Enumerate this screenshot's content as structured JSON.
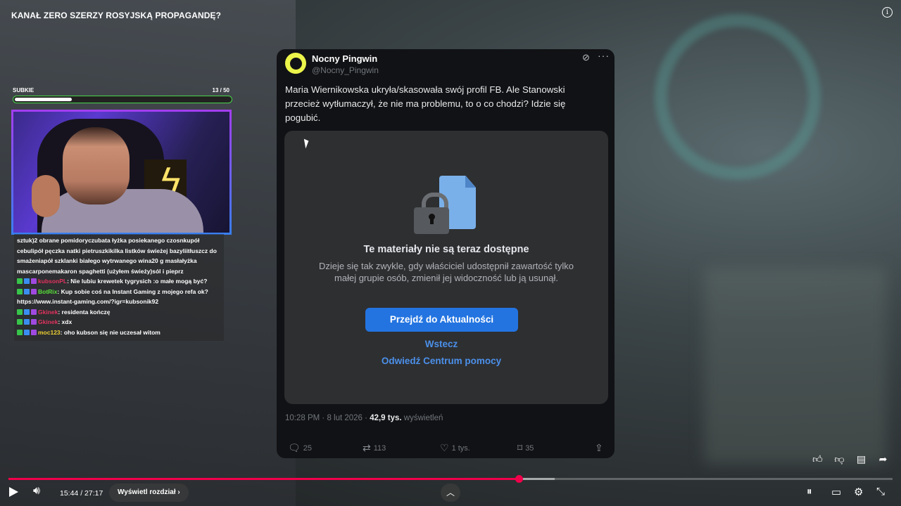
{
  "video": {
    "title": "KANAŁ ZERO SZERZY ROSYJSKĄ PROPAGANDĘ?",
    "info_icon": "i"
  },
  "subgoal": {
    "label": "SUBKIE",
    "current": "13",
    "sep_total": " / 50",
    "progress_fraction": 0.26
  },
  "chat": {
    "preceding_text": "sztuk)2 obrane pomidoryczubata łyżka posiekanego czosnkupół cebulipół pęczka natki pietruszkikilka listków świeżej bazyliitłuszcz do smażeniapół szklanki białego wytrwanego wina20 g masłałyżka mascarponemakaron spaghetti (użyłem świeży)sól i pieprz",
    "messages": [
      {
        "user": "kubsonPL",
        "user_color": "#e0335e",
        "text": ": Nie lubiu krewetek tygrysich :o małe mogą być?"
      },
      {
        "user": "BotRix",
        "user_color": "#58e03a",
        "text": ": Kup sobie coś na Instant Gaming z mojego refa ok?"
      },
      {
        "user": "",
        "user_color": "#ffffff",
        "text": "https://www.instant-gaming.com/?igr=kubsonik92"
      },
      {
        "user": "Gkinek",
        "user_color": "#e0335e",
        "text": ": residenta kończę"
      },
      {
        "user": "Gkinek",
        "user_color": "#e0335e",
        "text": ": xdx"
      },
      {
        "user": "moc123",
        "user_color": "#f0d030",
        "text": ": oho kubson się nie uczesał witom"
      }
    ]
  },
  "tweet": {
    "name": "Nocny Pingwin",
    "handle": "@Nocny_Pingwin",
    "body": "Maria Wiernikowska ukryła/skasowała swój profil FB. Ale Stanowski przecież wytłumaczył, że nie ma problemu, to o co chodzi? Idzie się pogubić.",
    "embed": {
      "title": "Te materiały nie są teraz dostępne",
      "description": "Dzieje się tak zwykle, gdy właściciel udostępnił zawartość tylko małej grupie osób, zmienił jej widoczność lub ją usunął.",
      "primary_button": "Przejdź do Aktualności",
      "back_link": "Wstecz",
      "help_link": "Odwiedź Centrum pomocy"
    },
    "meta_time": "10:28 PM · 8 lut 2026 · ",
    "meta_views": "42,9 tys.",
    "meta_views_label": " wyświetleń",
    "actions": {
      "replies": "25",
      "reposts": "113",
      "likes": "1 tys.",
      "bookmarks": "35"
    }
  },
  "player": {
    "current_time": "15:44",
    "duration": "27:17",
    "time_display": "15:44 / 27:17",
    "chapter_button": "Wyświetl rozdział",
    "played_fraction": 0.577,
    "accent": "#f0004a"
  }
}
